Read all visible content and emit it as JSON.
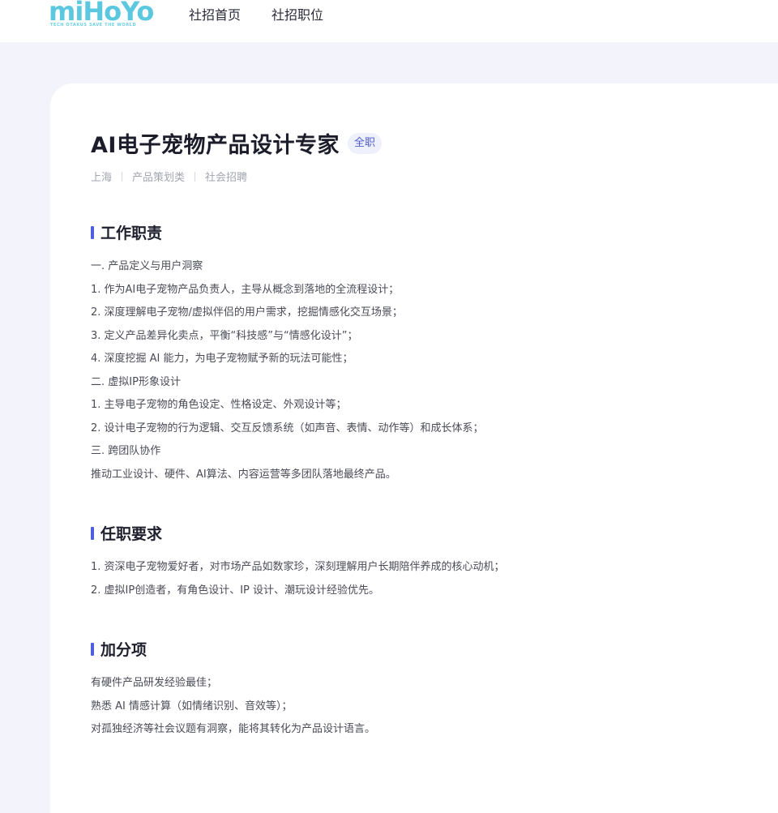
{
  "header": {
    "logo_text": "miHoYo",
    "logo_tagline": "TECH OTAKUS SAVE THE WORLD",
    "nav": [
      "社招首页",
      "社招职位"
    ]
  },
  "job": {
    "title": "AI电子宠物产品设计专家",
    "badge": "全职",
    "meta": [
      "上海",
      "产品策划类",
      "社会招聘"
    ]
  },
  "sections": [
    {
      "title": "工作职责",
      "lines": [
        "一. 产品定义与用户洞察",
        "1. 作为AI电子宠物产品负责人，主导从概念到落地的全流程设计；",
        "2. 深度理解电子宠物/虚拟伴侣的用户需求，挖掘情感化交互场景；",
        "3. 定义产品差异化卖点，平衡“科技感”与“情感化设计”；",
        "4. 深度挖掘 AI 能力，为电子宠物赋予新的玩法可能性；",
        "二. 虚拟IP形象设计",
        "1. 主导电子宠物的角色设定、性格设定、外观设计等；",
        "2. 设计电子宠物的行为逻辑、交互反馈系统（如声音、表情、动作等）和成长体系；",
        "三. 跨团队协作",
        "推动工业设计、硬件、AI算法、内容运营等多团队落地最终产品。"
      ]
    },
    {
      "title": "任职要求",
      "lines": [
        "1. 资深电子宠物爱好者，对市场产品如数家珍，深刻理解用户长期陪伴养成的核心动机；",
        "2. 虚拟IP创造者，有角色设计、IP 设计、潮玩设计经验优先。"
      ]
    },
    {
      "title": "加分项",
      "lines": [
        "有硬件产品研发经验最佳；",
        "熟悉 AI 情感计算（如情绪识别、音效等）；",
        "对孤独经济等社会议题有洞察，能将其转化为产品设计语言。"
      ]
    }
  ],
  "colors": {
    "accent": "#4d5fe0",
    "logo": "#5cc8e0",
    "page_bg": "#f3f4fb"
  }
}
